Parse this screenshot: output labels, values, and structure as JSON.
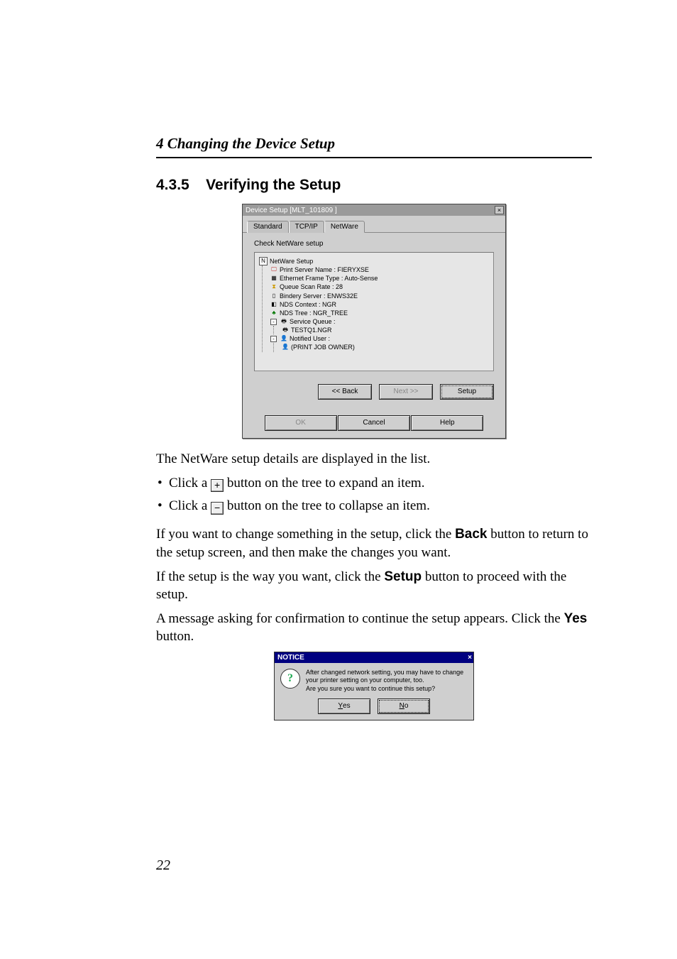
{
  "chapter": "4  Changing the Device Setup",
  "section_number": "4.3.5",
  "section_title": "Verifying the Setup",
  "dialog1": {
    "title": "Device Setup [MLT_101809 ]",
    "close_x": "×",
    "tabs": {
      "t1": "Standard",
      "t2": "TCP/IP",
      "t3": "NetWare"
    },
    "subtitle": "Check NetWare setup",
    "tree": {
      "root": "NetWare Setup",
      "l1": "Print Server Name : FIERYXSE",
      "l2": "Ethernet Frame Type : Auto-Sense",
      "l3": "Queue Scan Rate : 28",
      "l4": "Bindery Server : ENWS32E",
      "l5": "NDS Context : NGR",
      "l6": "NDS Tree : NGR_TREE",
      "l7": "Service Queue :",
      "l7a": "TESTQ1.NGR",
      "l8": "Notified User :",
      "l8a": "(PRINT JOB OWNER)"
    },
    "buttons": {
      "back": "<< Back",
      "next": "Next >>",
      "setup": "Setup",
      "ok": "OK",
      "cancel": "Cancel",
      "help": "Help"
    }
  },
  "paragraphs": {
    "p1": "The NetWare setup details are displayed in the list.",
    "b1a": "Click a ",
    "b1b": " button on the tree to expand an item.",
    "b2a": "Click a ",
    "b2b": " button on the tree to collapse an item.",
    "p2a": "If you want to change something in the setup, click the ",
    "p2b": " button to return to the setup screen, and then make the changes you want.",
    "p3a": "If the setup is the way you want, click the ",
    "p3b": " button to proceed with the setup.",
    "p4a": "A message asking for confirmation to continue the setup appears. Click the ",
    "p4b": " button.",
    "bold_back": "Back",
    "bold_setup": "Setup",
    "bold_yes": "Yes"
  },
  "plus": "+",
  "minus": "−",
  "dialog2": {
    "title": "NOTICE",
    "close_x": "×",
    "q": "?",
    "msg": "After changed network setting, you may have to change your printer setting on your computer, too.\nAre you sure you want to continue this setup?",
    "yes": "Yes",
    "no": "No",
    "yes_u": "Y",
    "no_u": "N"
  },
  "page_number": "22"
}
